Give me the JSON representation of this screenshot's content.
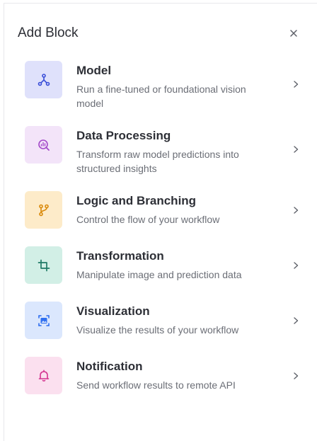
{
  "header": {
    "title": "Add Block"
  },
  "items": [
    {
      "name": "Model",
      "description": "Run a fine-tuned or foundational vision model",
      "icon": "model-nodes-icon",
      "tile_color": "#dfe1fb",
      "icon_color": "#3b4fd8"
    },
    {
      "name": "Data Processing",
      "description": "Transform raw model predictions into structured insights",
      "icon": "magnify-chart-icon",
      "tile_color": "#f3e4f9",
      "icon_color": "#a349c9"
    },
    {
      "name": "Logic and Branching",
      "description": "Control the flow of your workflow",
      "icon": "git-branch-icon",
      "tile_color": "#fdebc9",
      "icon_color": "#d9890a"
    },
    {
      "name": "Transformation",
      "description": "Manipulate image and prediction data",
      "icon": "crop-icon",
      "tile_color": "#d2efe6",
      "icon_color": "#1f7a66"
    },
    {
      "name": "Visualization",
      "description": "Visualize the results of your workflow",
      "icon": "frame-image-icon",
      "tile_color": "#dbe7fd",
      "icon_color": "#2f6ff0"
    },
    {
      "name": "Notification",
      "description": "Send workflow results to remote API",
      "icon": "bell-icon",
      "tile_color": "#fbe0ef",
      "icon_color": "#d4328f"
    }
  ]
}
